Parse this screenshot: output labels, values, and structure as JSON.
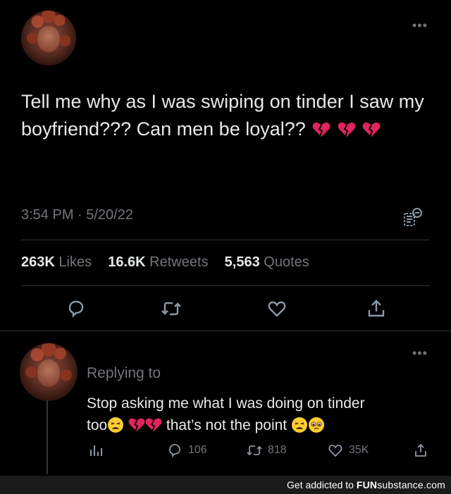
{
  "tweet": {
    "text": "Tell me why as I was swiping on tinder I saw my boyfriend??? Can men be loyal??",
    "timestamp": "3:54 PM · 5/20/22",
    "likes_count": "263K",
    "likes_label": "Likes",
    "retweets_count": "16.6K",
    "retweets_label": "Retweets",
    "quotes_count": "5,563",
    "quotes_label": "Quotes",
    "more_icon": "more-dots-icon",
    "icons": [
      "reply-icon",
      "retweet-icon",
      "like-icon",
      "share-icon",
      "analytics-icon"
    ]
  },
  "reply": {
    "replying_label": "Replying to",
    "text_line1": "Stop asking me what I was doing on tinder",
    "text_line2_start": "too",
    "text_line2_middle": "that’s not the point",
    "reply_count": "106",
    "retweet_count": "818",
    "like_count": "35K",
    "icons": [
      "stats-icon",
      "reply-icon",
      "retweet-icon",
      "like-icon",
      "share-icon"
    ]
  },
  "footer": {
    "lead": "Get addicted to ",
    "brand_bold": "FUN",
    "brand_normal": "substance",
    "brand_tail": ".com"
  },
  "colors": {
    "background": "#000000",
    "text": "#e7e9ea",
    "muted": "#71767b",
    "divider": "#2f3336",
    "heart_red": "#e0245e",
    "emoji_yellow": "#ffcc33"
  }
}
